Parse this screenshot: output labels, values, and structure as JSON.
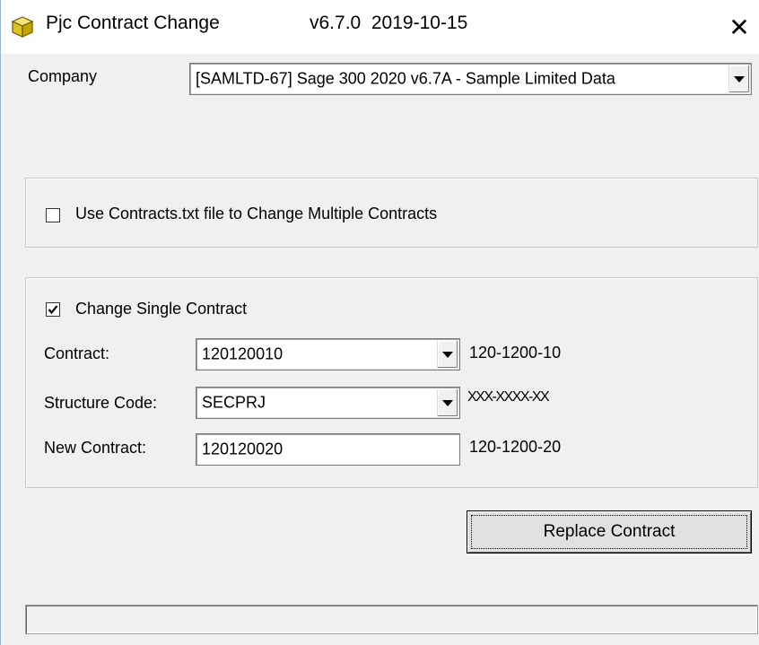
{
  "window": {
    "title": "Pjc Contract Change",
    "version": "v6.7.0  2019-10-15",
    "close_symbol": "✕",
    "icon": "cube-icon"
  },
  "company": {
    "label": "Company",
    "value": "[SAMLTD-67] Sage 300 2020 v6.7A - Sample Limited Data"
  },
  "multi": {
    "checkbox_label": "Use Contracts.txt file to Change Multiple Contracts",
    "checked": false
  },
  "single": {
    "checkbox_label": "Change Single Contract",
    "checked": true,
    "contract_label": "Contract:",
    "contract_value": "120120010",
    "contract_formatted": "120-1200-10",
    "structure_label": "Structure Code:",
    "structure_value": "SECPRJ",
    "structure_mask": "XXX-XXXX-XX",
    "new_contract_label": "New Contract:",
    "new_contract_value": "120120020",
    "new_contract_formatted": "120-1200-20"
  },
  "actions": {
    "replace_label": "Replace Contract"
  },
  "status": {
    "text": ""
  }
}
